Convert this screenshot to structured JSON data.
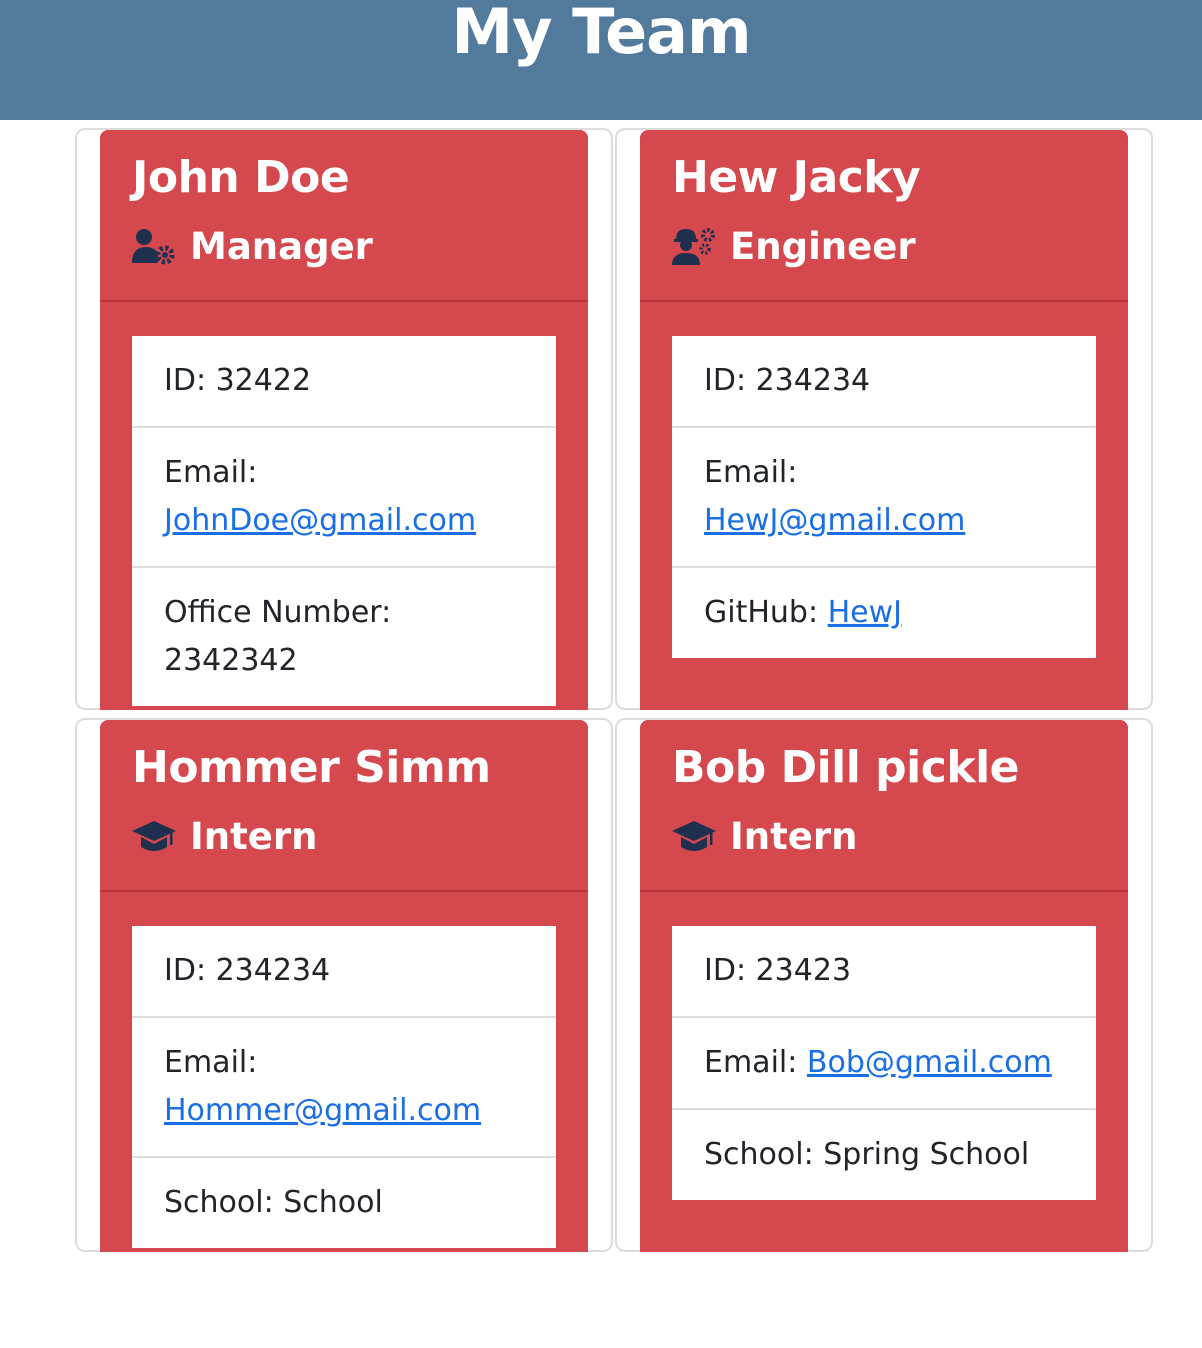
{
  "header": {
    "title": "My Team"
  },
  "cards": [
    {
      "name": "John Doe",
      "role": "Manager",
      "role_icon": "user-gear-icon",
      "id_label": "ID: 32422",
      "email_label": "Email:",
      "email": "JohnDoe@gmail.com",
      "extra_label": "Office Number:",
      "extra_value": "2342342"
    },
    {
      "name": "Hew Jacky",
      "role": "Engineer",
      "role_icon": "engineer-gears-icon",
      "id_label": "ID: 234234",
      "email_label": "Email:",
      "email": "HewJ@gmail.com",
      "extra_label": "GitHub:",
      "extra_value": "HewJ"
    },
    {
      "name": "Hommer Simm",
      "role": "Intern",
      "role_icon": "graduation-cap-icon",
      "id_label": "ID: 234234",
      "email_label": "Email:",
      "email": "Hommer@gmail.com",
      "extra_label": "School:",
      "extra_value": "School"
    },
    {
      "name": "Bob Dill pickle",
      "role": "Intern",
      "role_icon": "graduation-cap-icon",
      "id_label": "ID: 23423",
      "email_label": "Email:",
      "email": "Bob@gmail.com",
      "extra_label": "School:",
      "extra_value": "Spring School"
    }
  ],
  "colors": {
    "header_bg": "#527a9c",
    "card_bg": "#d4484e",
    "link": "#1a6ee6",
    "icon": "#1f2f4e"
  }
}
